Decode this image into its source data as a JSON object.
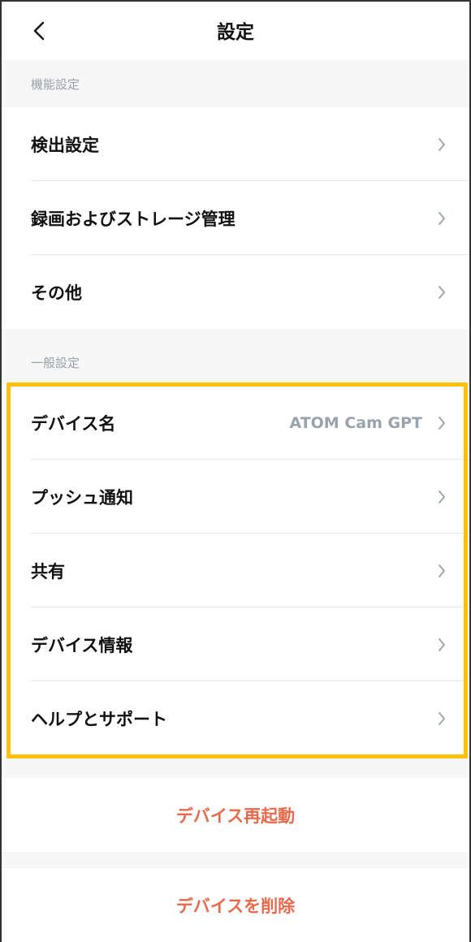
{
  "header": {
    "title": "設定"
  },
  "sections": {
    "function": {
      "title": "機能設定",
      "items": [
        {
          "label": "検出設定"
        },
        {
          "label": "録画およびストレージ管理"
        },
        {
          "label": "その他"
        }
      ]
    },
    "general": {
      "title": "一般設定",
      "items": [
        {
          "label": "デバイス名",
          "value": "ATOM Cam GPT"
        },
        {
          "label": "プッシュ通知"
        },
        {
          "label": "共有"
        },
        {
          "label": "デバイス情報"
        },
        {
          "label": "ヘルプとサポート"
        }
      ]
    }
  },
  "actions": {
    "restart_label": "デバイス再起動",
    "delete_label": "デバイスを削除"
  },
  "colors": {
    "highlight": "#ffc107",
    "danger": "#e8694b",
    "secondary_text": "#9aa3ad"
  }
}
